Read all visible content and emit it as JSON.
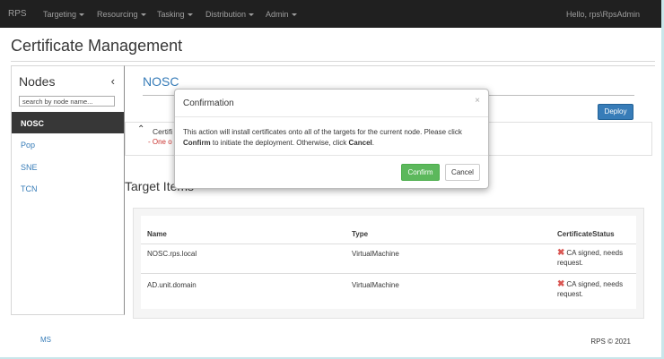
{
  "navbar": {
    "brand": "RPS",
    "items": [
      "Targeting",
      "Resourcing",
      "Tasking",
      "Distribution",
      "Admin"
    ],
    "user_greeting": "Hello, rps\\RpsAdmin"
  },
  "page": {
    "title": "Certificate Management"
  },
  "sidebar": {
    "title": "Nodes",
    "search_placeholder": "search by node name...",
    "items": [
      "NOSC",
      "Pop",
      "SNE",
      "TCN"
    ],
    "active_item": "NOSC"
  },
  "main": {
    "node_title": "NOSC",
    "deploy_label": "Deploy",
    "cert_label_visible": "Certifi",
    "cert_error_visible": "- One o",
    "target_items_title": "Target Items",
    "table": {
      "headers": [
        "Name",
        "Type",
        "CertificateStatus"
      ],
      "rows": [
        {
          "name": "NOSC.rps.local",
          "type": "VirtualMachine",
          "status": "CA signed, needs request."
        },
        {
          "name": "AD.unit.domain",
          "type": "VirtualMachine",
          "status": "CA signed, needs request."
        }
      ]
    }
  },
  "modal": {
    "title": "Confirmation",
    "close_glyph": "×",
    "body_prefix": "This action will install certificates onto all of the targets for the current node. Please click ",
    "confirm_word": "Confirm",
    "body_middle": " to initiate the deployment. Otherwise, click ",
    "cancel_word": "Cancel",
    "body_suffix": ".",
    "confirm_label": "Confirm",
    "cancel_label": "Cancel"
  },
  "footer": {
    "link": "MS",
    "copyright": "RPS © 2021"
  },
  "colors": {
    "navbar_bg": "#1c1c1c",
    "primary": "#337ab7",
    "success": "#5cb85c",
    "danger": "#d9534f",
    "active_node_bg": "#333333"
  }
}
